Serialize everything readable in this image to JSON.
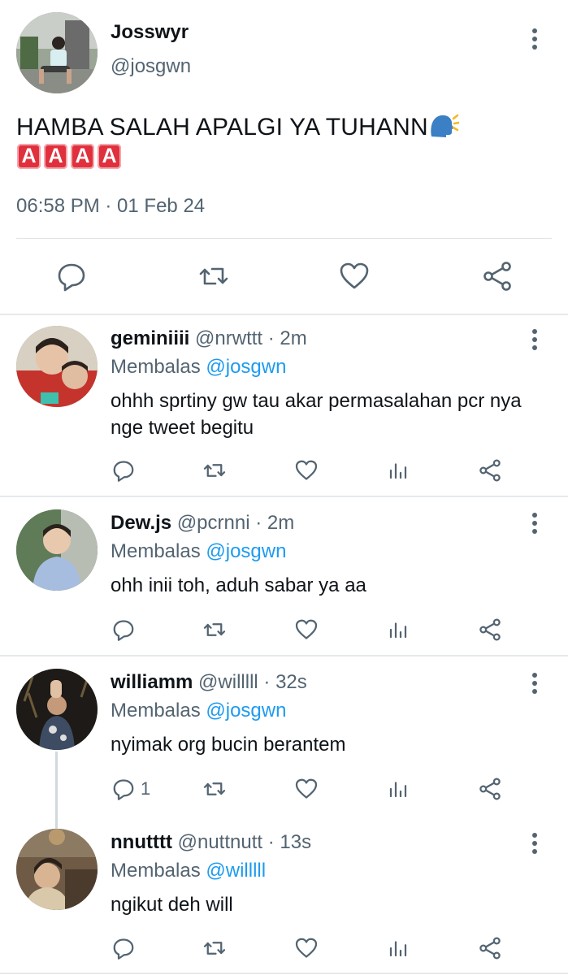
{
  "main_tweet": {
    "name": "Josswyr",
    "handle": "@josgwn",
    "text": "HAMBA SALAH APALGI YA TUHANN",
    "badges": [
      "A",
      "A",
      "A",
      "A"
    ],
    "timestamp": "06:58 PM · 01 Feb 24",
    "actions": [
      "reply-icon",
      "retweet-icon",
      "like-icon",
      "share-icon"
    ]
  },
  "replies": [
    {
      "name": "geminiiii",
      "meta": "@nrwttt · 2m",
      "reply_label": "Membalas",
      "reply_to": "@josgwn",
      "text": "ohhh sprtiny gw tau akar permasalahan pcr nya nge tweet begitu",
      "reply_count": ""
    },
    {
      "name": "Dew.js",
      "meta": "@pcrnni · 2m",
      "reply_label": "Membalas",
      "reply_to": "@josgwn",
      "text": "ohh inii toh, aduh sabar ya aa",
      "reply_count": ""
    },
    {
      "name": "williamm",
      "meta": "@willlll · 32s",
      "reply_label": "Membalas",
      "reply_to": "@josgwn",
      "text": "nyimak org bucin berantem",
      "reply_count": "1"
    },
    {
      "name": "nnutttt",
      "meta": "@nuttnutt · 13s",
      "reply_label": "Membalas",
      "reply_to": "@willlll",
      "text": "ngikut deh will",
      "reply_count": ""
    }
  ],
  "colors": {
    "text": "#0f1419",
    "secondary": "#536471",
    "mention": "#1d9bf0",
    "badge": "#e0303d"
  }
}
